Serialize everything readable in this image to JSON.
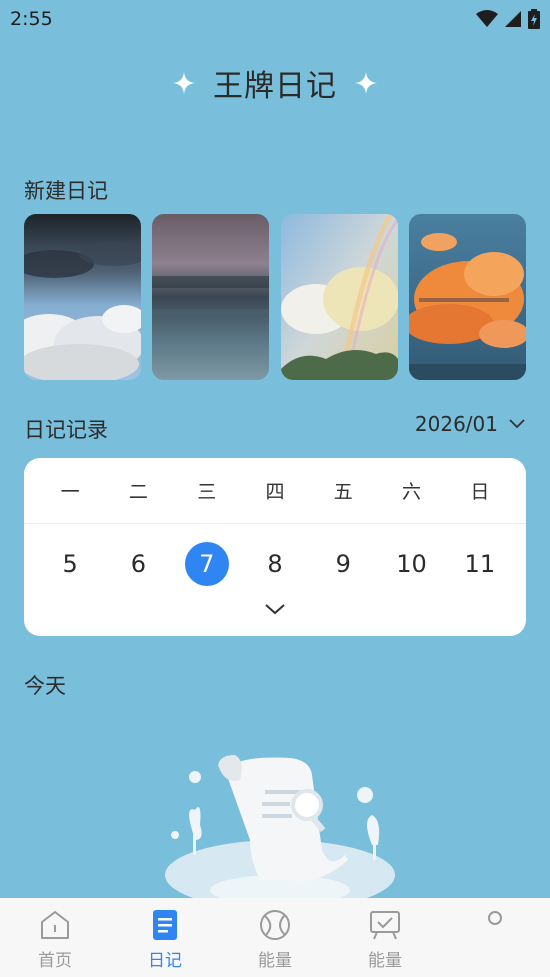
{
  "status_bar": {
    "time": "2:55"
  },
  "header": {
    "title": "王牌日记"
  },
  "new_diary": {
    "label": "新建日记",
    "cards": [
      {
        "name": "storm-cloud-card"
      },
      {
        "name": "sea-card"
      },
      {
        "name": "rainbow-card"
      },
      {
        "name": "sunset-cloud-card"
      }
    ]
  },
  "records": {
    "label": "日记记录",
    "month": "2026/01"
  },
  "calendar": {
    "weekdays": [
      "一",
      "二",
      "三",
      "四",
      "五",
      "六",
      "日"
    ],
    "dates": [
      "5",
      "6",
      "7",
      "8",
      "9",
      "10",
      "11"
    ],
    "selected": "7",
    "accent": "#2f86f2"
  },
  "today": {
    "label": "今天"
  },
  "bottom_nav": {
    "items": [
      {
        "label": "首页",
        "icon": "home-icon",
        "active": false
      },
      {
        "label": "日记",
        "icon": "diary-icon",
        "active": true
      },
      {
        "label": "能量",
        "icon": "ball-icon",
        "active": false
      },
      {
        "label": "能量",
        "icon": "board-check-icon",
        "active": false
      },
      {
        "label": "",
        "icon": "circle-icon",
        "active": false
      }
    ]
  },
  "colors": {
    "background": "#79bfdc",
    "nav_bg": "#f7f7f7",
    "active": "#2f86f2"
  }
}
